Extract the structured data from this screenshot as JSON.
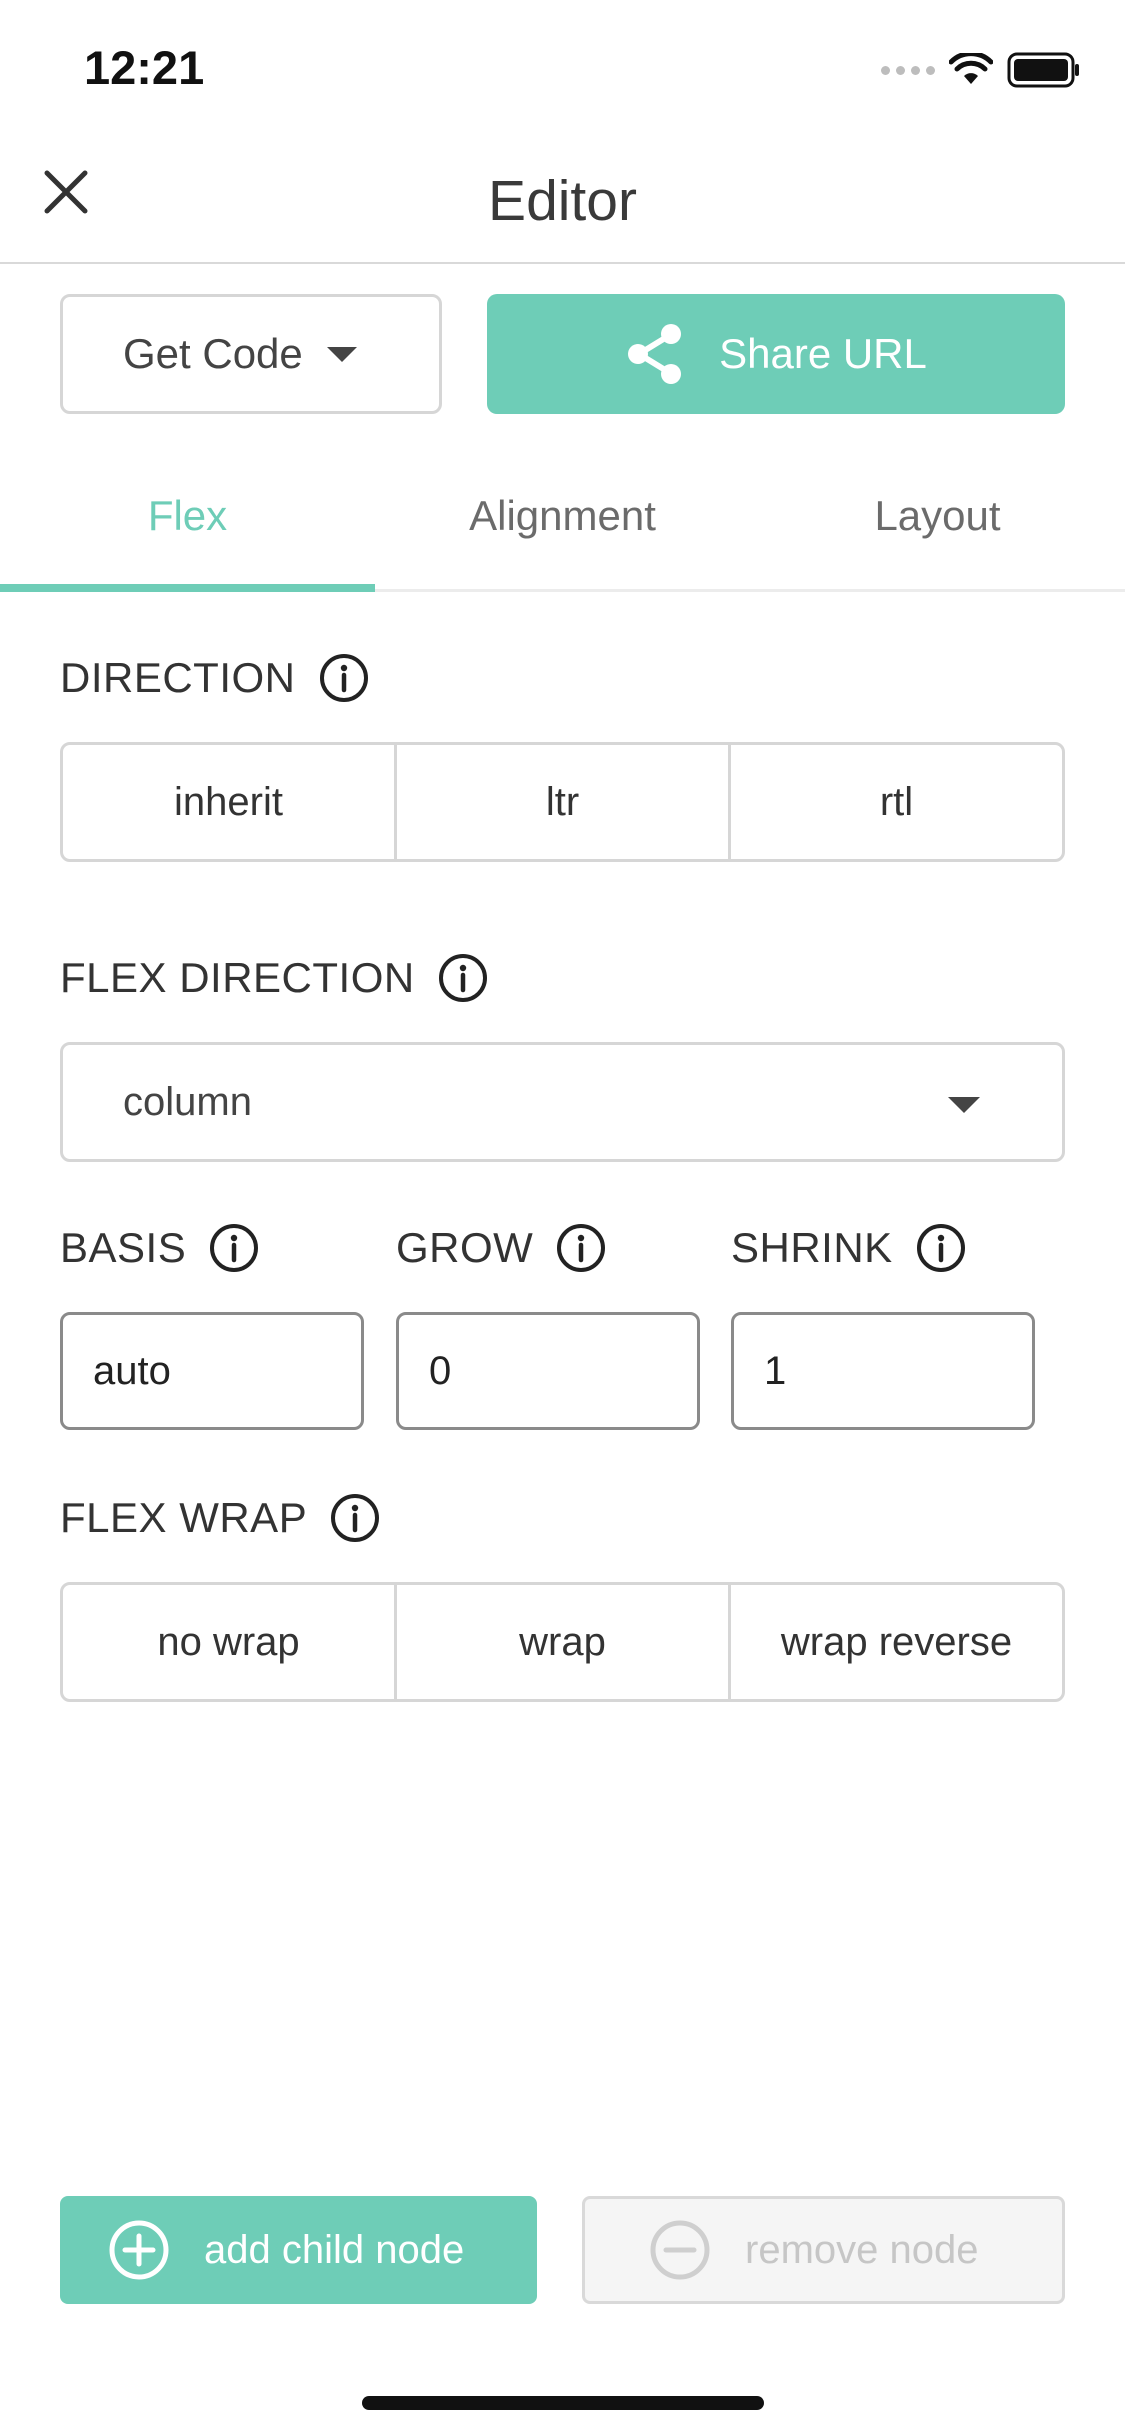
{
  "status_bar": {
    "time": "12:21"
  },
  "header": {
    "title": "Editor"
  },
  "actions": {
    "get_code_label": "Get Code",
    "share_url_label": "Share URL"
  },
  "tabs": [
    {
      "label": "Flex",
      "active": true
    },
    {
      "label": "Alignment",
      "active": false
    },
    {
      "label": "Layout",
      "active": false
    }
  ],
  "direction": {
    "label": "DIRECTION",
    "options": [
      "inherit",
      "ltr",
      "rtl"
    ]
  },
  "flex_direction": {
    "label": "FLEX DIRECTION",
    "selected": "column"
  },
  "basis": {
    "label": "BASIS",
    "value": "auto"
  },
  "grow": {
    "label": "GROW",
    "value": "0"
  },
  "shrink": {
    "label": "SHRINK",
    "value": "1"
  },
  "flex_wrap": {
    "label": "FLEX WRAP",
    "options": [
      "no wrap",
      "wrap",
      "wrap reverse"
    ]
  },
  "bottom": {
    "add_child_label": "add child node",
    "remove_node_label": "remove node"
  },
  "colors": {
    "accent": "#6ecdb7",
    "border": "#d6d6d6",
    "text": "#333333"
  },
  "icons": [
    "close-icon",
    "caret-down-icon",
    "share-icon",
    "info-icon",
    "plus-circle-icon",
    "minus-circle-icon",
    "wifi-icon",
    "battery-icon",
    "signal-icon"
  ]
}
